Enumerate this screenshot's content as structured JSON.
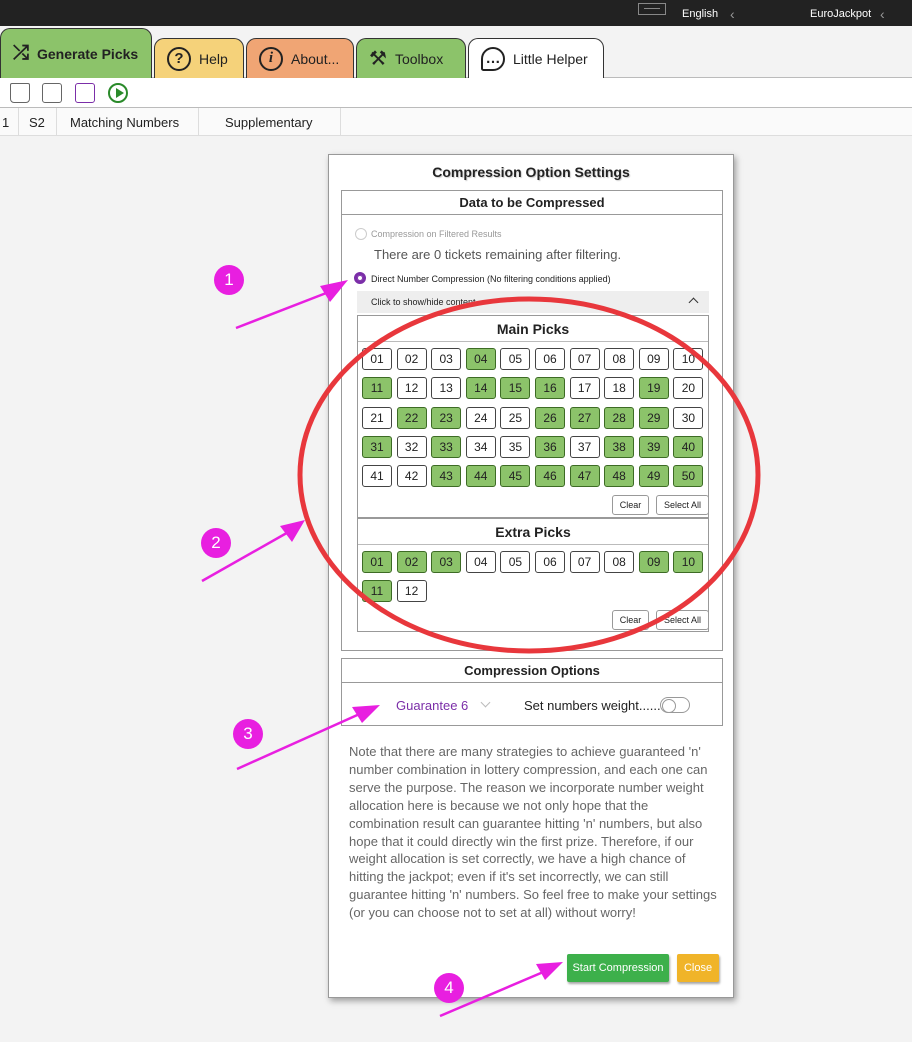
{
  "titlebar": {
    "language": "English",
    "app_name": "EuroJackpot"
  },
  "tabs": [
    {
      "label": "Generate Picks",
      "icon": "shuffle-icon",
      "color": "#8cc36a",
      "glyph": "⤮"
    },
    {
      "label": "Help",
      "icon": "question-icon",
      "color": "#f5d27a",
      "glyph": "?"
    },
    {
      "label": "About...",
      "icon": "info-icon",
      "color": "#f0a574",
      "glyph": "i"
    },
    {
      "label": "Toolbox",
      "icon": "toolbox-icon",
      "color": "#8cc36a",
      "glyph": "⚒"
    },
    {
      "label": "Little Helper",
      "icon": "chat-bubble-icon",
      "color": "#ffffff",
      "glyph": "…"
    }
  ],
  "columns": [
    "1",
    "S2",
    "Matching Numbers",
    "Supplementary"
  ],
  "dialog": {
    "title": "Compression Option Settings",
    "data_section": {
      "title": "Data to be Compressed",
      "option_filtered": "Compression on Filtered Results",
      "filtered_info": "There are 0 tickets remaining after filtering.",
      "option_direct": "Direct Number Compression (No filtering conditions applied)",
      "toggle_content": "Click to show/hide content"
    },
    "main_picks": {
      "title": "Main Picks",
      "numbers": [
        "01",
        "02",
        "03",
        "04",
        "05",
        "06",
        "07",
        "08",
        "09",
        "10",
        "11",
        "12",
        "13",
        "14",
        "15",
        "16",
        "17",
        "18",
        "19",
        "20",
        "21",
        "22",
        "23",
        "24",
        "25",
        "26",
        "27",
        "28",
        "29",
        "30",
        "31",
        "32",
        "33",
        "34",
        "35",
        "36",
        "37",
        "38",
        "39",
        "40",
        "41",
        "42",
        "43",
        "44",
        "45",
        "46",
        "47",
        "48",
        "49",
        "50"
      ],
      "selected": [
        "04",
        "11",
        "14",
        "15",
        "16",
        "19",
        "22",
        "23",
        "26",
        "27",
        "28",
        "29",
        "31",
        "33",
        "36",
        "38",
        "39",
        "40",
        "43",
        "44",
        "45",
        "46",
        "47",
        "48",
        "49",
        "50"
      ],
      "clear": "Clear",
      "select_all": "Select All"
    },
    "extra_picks": {
      "title": "Extra Picks",
      "numbers": [
        "01",
        "02",
        "03",
        "04",
        "05",
        "06",
        "07",
        "08",
        "09",
        "10",
        "11",
        "12"
      ],
      "selected": [
        "01",
        "02",
        "03",
        "09",
        "10",
        "11"
      ],
      "clear": "Clear",
      "select_all": "Select All"
    },
    "options": {
      "title": "Compression Options",
      "guarantee": "Guarantee 6",
      "weight_label": "Set numbers weight......",
      "weight_enabled": false
    },
    "note": "Note that there are many strategies to achieve guaranteed 'n' number combination in lottery compression, and each one can serve the purpose. The reason we incorporate number weight allocation here is because we not only hope that the combination result can guarantee hitting 'n' numbers, but also hope that it could directly win the first prize. Therefore, if our weight allocation is set correctly, we have a high chance of hitting the jackpot; even if it's set incorrectly, we can still guarantee hitting 'n' numbers. So feel free to make your settings (or you can choose not to set at all) without worry!",
    "start_button": "Start Compression",
    "close_button": "Close"
  },
  "annotations": [
    "1",
    "2",
    "3",
    "4"
  ],
  "colors": {
    "selected_number": "#8cc36a",
    "accent": "#7b2ea8",
    "annotation": "#e81fe0",
    "highlight_ring": "#e8373c",
    "start": "#3db04b",
    "close": "#f0b429"
  }
}
